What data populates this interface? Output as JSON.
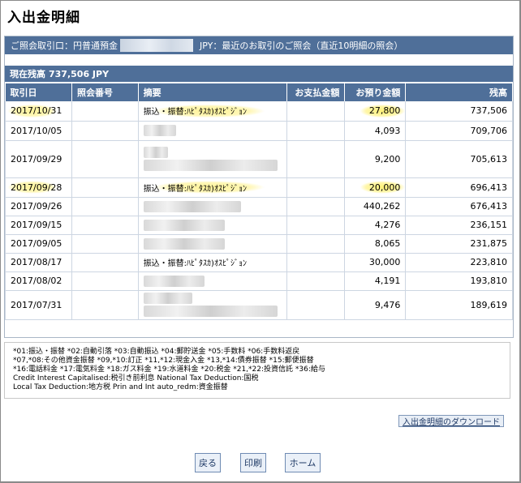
{
  "page": {
    "title": "入出金明細"
  },
  "account": {
    "label": "ご照会取引口：円普通預金",
    "currency": "JPY：最近のお取引のご照会（直近10明細の照会）"
  },
  "balance": {
    "label": "現在残高",
    "amount": "737,506 JPY"
  },
  "table": {
    "headers": {
      "date": "取引日",
      "ref": "照会番号",
      "desc": "摘要",
      "withdraw": "お支払金額",
      "deposit": "お預り金額",
      "balance": "残高"
    },
    "rows": [
      {
        "date": "2017/10/31",
        "desc": "振込・振替:ﾊﾋﾟﾀｽｶ)ｵｽﾋﾟｼﾞｮﾝ",
        "deposit": "27,800",
        "balance": "737,506"
      },
      {
        "date": "2017/10/05",
        "desc": "",
        "deposit": "4,093",
        "balance": "709,706"
      },
      {
        "date": "2017/09/29",
        "desc": "",
        "deposit": "9,200",
        "balance": "705,613"
      },
      {
        "date": "2017/09/28",
        "desc": "振込・振替:ﾊﾋﾟﾀｽｶ)ｵｽﾋﾟｼﾞｮﾝ",
        "deposit": "20,000",
        "balance": "696,413"
      },
      {
        "date": "2017/09/26",
        "desc": "",
        "deposit": "440,262",
        "balance": "676,413"
      },
      {
        "date": "2017/09/15",
        "desc": "",
        "deposit": "4,276",
        "balance": "236,151"
      },
      {
        "date": "2017/09/05",
        "desc": "",
        "deposit": "8,065",
        "balance": "231,875"
      },
      {
        "date": "2017/08/17",
        "desc": "振込・振替:ﾊﾋﾟﾀｽｶ)ｵｽﾋﾟｼﾞｮﾝ",
        "deposit": "30,000",
        "balance": "223,810"
      },
      {
        "date": "2017/08/02",
        "desc": "",
        "deposit": "4,191",
        "balance": "193,810"
      },
      {
        "date": "2017/07/31",
        "desc": "",
        "deposit": "9,476",
        "balance": "189,619"
      }
    ]
  },
  "legend": {
    "line1": "*01:振込・振替 *02:自動引落 *03:自動振込 *04:郵貯送金 *05:手数料 *06:手数料返戻",
    "line2": "*07,*08:その他資金振替 *09,*10:訂正 *11,*12:現金入金 *13,*14:債券振替 *15:郵便振替",
    "line3": "*16:電話料金 *17:電気料金 *18:ガス料金 *19:水道料金 *20:税金 *21,*22:投資信託 *36:給与",
    "line4": "Credit Interest Capitalised:税引き前利息 National Tax Deduction:国税",
    "line5": "Local Tax Deduction:地方税 Prin and Int auto_redm:資金振替"
  },
  "links": {
    "download": "入出金明細のダウンロード"
  },
  "buttons": {
    "back": "戻る",
    "print": "印刷",
    "home": "ホーム"
  }
}
